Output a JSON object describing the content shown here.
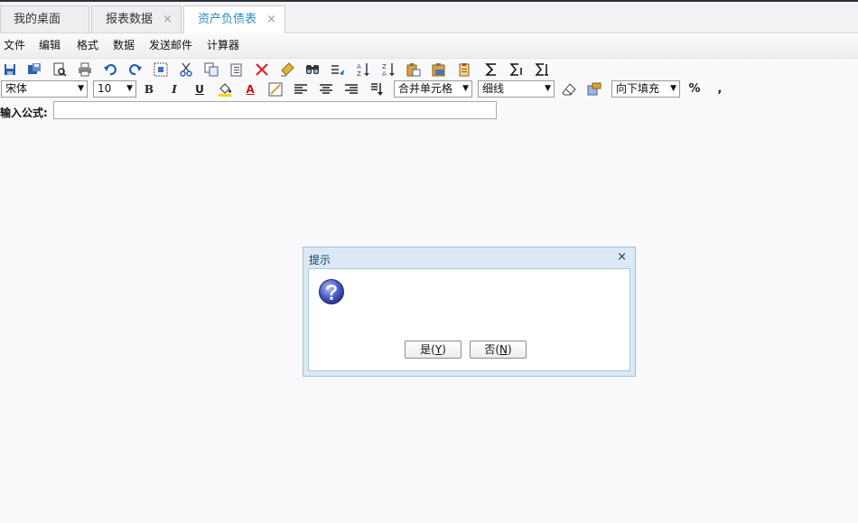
{
  "tabs": [
    {
      "label": "我的桌面",
      "closable": false
    },
    {
      "label": "报表数据",
      "closable": true
    },
    {
      "label": "资产负债表",
      "closable": true,
      "active": true
    }
  ],
  "tab_close_glyph": "×",
  "menu": [
    "文件",
    "编辑",
    "格式",
    "数据",
    "发送邮件",
    "计算器"
  ],
  "toolbar1_icons": [
    "save-icon",
    "save-as-icon",
    "print-preview-icon",
    "print-icon",
    "undo-icon",
    "redo-icon",
    "select-range-icon",
    "cut-icon",
    "copy-icon",
    "paste-icon",
    "delete-icon",
    "clear-format-icon",
    "find-icon",
    "replace-icon",
    "sort-ascending-icon",
    "sort-descending-icon",
    "paste-special-icon",
    "paste-values-icon",
    "clipboard-icon",
    "sum-icon",
    "sum-row-icon",
    "sum-column-icon"
  ],
  "toolbar2": {
    "font_name": "宋体",
    "font_size": "10",
    "bold": "B",
    "italic": "I",
    "underline": "U",
    "font_color": "A",
    "merge": "合并单元格",
    "border": "细线",
    "fill": "向下填充",
    "percent": "%",
    "comma": ","
  },
  "formula": {
    "label": "输入公式:",
    "value": ""
  },
  "dialog": {
    "title": "提示",
    "close": "×",
    "yes_text": "是(",
    "yes_key": "Y",
    "yes_end": ")",
    "no_text": "否(",
    "no_key": "N",
    "no_end": ")"
  },
  "colors": {
    "accent_tab": "#2d8fc7",
    "dialog_header": "#dbe9f4",
    "dialog_border": "#9fc2dc"
  }
}
